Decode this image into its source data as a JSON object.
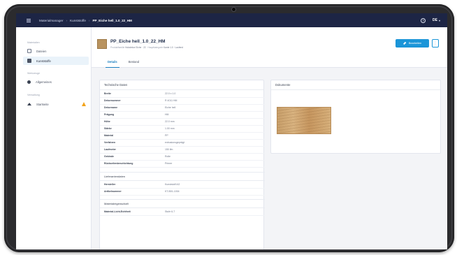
{
  "topbar": {
    "crumbs": [
      "Materialmanager",
      "Kunststoffe",
      "PP_Eiche hell_1.0_22_HM"
    ],
    "lang": "DE"
  },
  "sidebar": {
    "section_1": "Materialien",
    "item_files": "Dateien",
    "item_catalog": "Kunststoffe",
    "section_2": "Werkzeuge",
    "item_settings": "Allgemeines",
    "section_3": "Verwaltung",
    "item_home": "Startseite"
  },
  "header": {
    "title": "PP_Eiche hell_1.0_22_HM",
    "subtitle_label_1": "Produktfamilie",
    "subtitle_value_1": "Holzdekor Eiche · 22",
    "subtitle_label_2": "Hauptkategorie",
    "subtitle_value_2": "Kante 1.0 · Laufend",
    "edit_label": "Bearbeiten",
    "more_label": "⋮"
  },
  "tabs": [
    "Details",
    "Bestand"
  ],
  "tech_card": {
    "title": "Technische Daten",
    "rows": [
      {
        "k": "Breite",
        "v": "22.0 x 1.0"
      },
      {
        "k": "Dekornummer",
        "v": "R 4011 HM"
      },
      {
        "k": "Dekorname",
        "v": "Eiche hell"
      },
      {
        "k": "Prägung",
        "v": "HM"
      },
      {
        "k": "Höhe",
        "v": "22.0 mm"
      },
      {
        "k": "Stärke",
        "v": "1.00 mm"
      },
      {
        "k": "Material",
        "v": "PP"
      },
      {
        "k": "Verfahren",
        "v": "extrusionsgeprägt"
      },
      {
        "k": "Laufmeter",
        "v": "150 lfm"
      },
      {
        "k": "Gebinde",
        "v": "Rolle"
      },
      {
        "k": "Rückseitenbeschichtung",
        "v": "Primer"
      }
    ],
    "section_2": "Lieferantendaten",
    "rows_2": [
      {
        "k": "Hersteller",
        "v": "Kunststoff AG"
      },
      {
        "k": "Artikelnummer",
        "v": "KT-B01-1004"
      }
    ],
    "section_3": "Materialeigenschaft",
    "rows_3": [
      {
        "k": "Material-Licht-Echtheit",
        "v": "Stufe 6-7"
      }
    ]
  },
  "docs_card": {
    "title": "Dokumente"
  }
}
